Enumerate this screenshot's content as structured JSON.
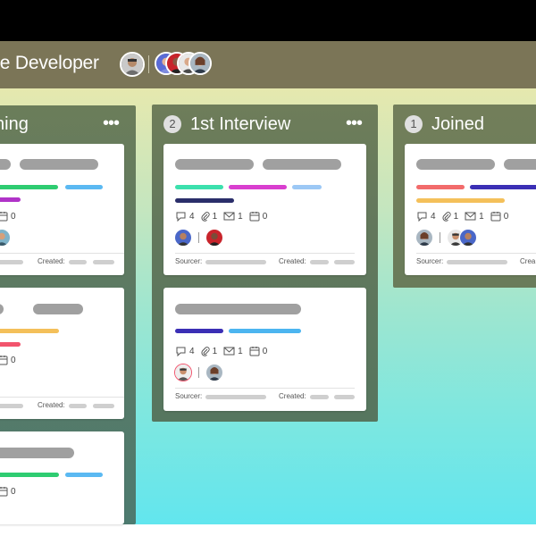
{
  "job": {
    "title": "re Developer"
  },
  "columns": [
    {
      "name": "ning",
      "count": "",
      "menu": "•••"
    },
    {
      "name": "1st Interview",
      "count": "2",
      "menu": "•••"
    },
    {
      "name": "Joined",
      "count": "1",
      "menu": "•••"
    }
  ],
  "labels": {
    "sourcer": "Sourcer:",
    "created": "Created:",
    "created_short": "Crea"
  },
  "icons": {
    "comment": "comment-icon",
    "attachment": "paperclip-icon",
    "mail": "mail-icon",
    "calendar": "calendar-icon",
    "menu": "more-icon"
  },
  "cards": {
    "left1": {
      "calendar": "0",
      "tags": [
        "#2ecc71",
        "#5bb9f2",
        "#b033c8"
      ]
    },
    "left2": {
      "calendar": "0",
      "tags": [
        "#f4c05a",
        "#f2546d"
      ]
    },
    "left3": {
      "calendar": "0",
      "tags": [
        "#2ecc71",
        "#5bb9f2"
      ]
    },
    "mid1": {
      "comments": "4",
      "attachments": "1",
      "mails": "1",
      "calendar": "0",
      "tags": [
        "#3ce0ad",
        "#d93fcf",
        "#9cc8f5",
        "#2a2e6a"
      ]
    },
    "mid2": {
      "comments": "4",
      "attachments": "1",
      "mails": "1",
      "calendar": "0",
      "tags": [
        "#3b2fb5",
        "#4cb5f0"
      ]
    },
    "right1": {
      "comments": "4",
      "attachments": "1",
      "mails": "1",
      "calendar": "0",
      "tags": [
        "#f26b6b",
        "#3b2fb5",
        "#f4c05a"
      ]
    }
  },
  "colors": {
    "header": "#7b7557",
    "topbar": "#000000",
    "count_badge": "#e0e0e0"
  }
}
